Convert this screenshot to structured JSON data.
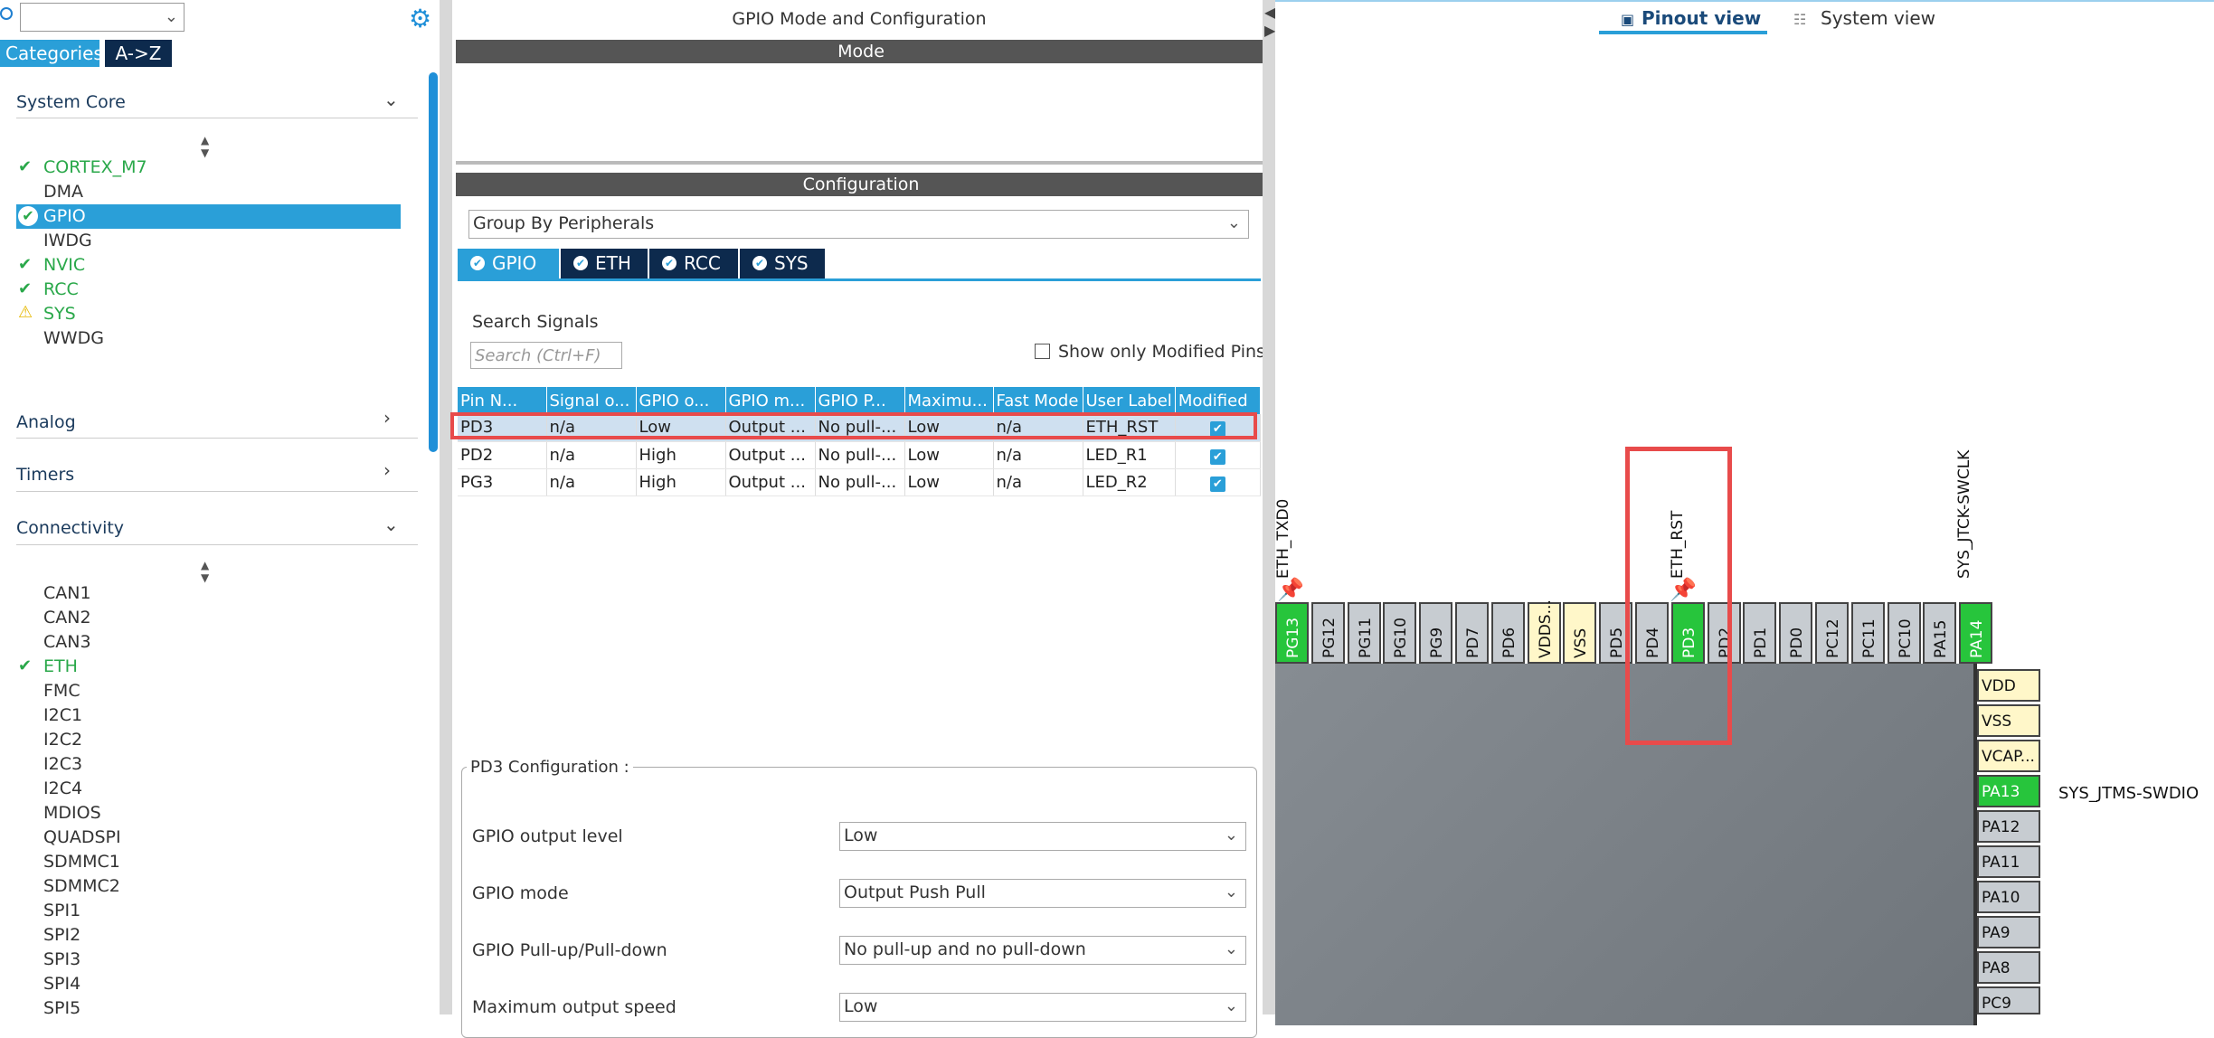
{
  "left": {
    "tabs": [
      "Categories",
      "A->Z"
    ],
    "sections": {
      "system_core": "System Core",
      "analog": "Analog",
      "timers": "Timers",
      "connectivity": "Connectivity"
    },
    "system_core_items": [
      "CORTEX_M7",
      "DMA",
      "GPIO",
      "IWDG",
      "NVIC",
      "RCC",
      "SYS",
      "WWDG"
    ],
    "connectivity_items": [
      "CAN1",
      "CAN2",
      "CAN3",
      "ETH",
      "FMC",
      "I2C1",
      "I2C2",
      "I2C3",
      "I2C4",
      "MDIOS",
      "QUADSPI",
      "SDMMC1",
      "SDMMC2",
      "SPI1",
      "SPI2",
      "SPI3",
      "SPI4",
      "SPI5"
    ]
  },
  "center": {
    "title": "GPIO Mode and Configuration",
    "mode_bar": "Mode",
    "config_bar": "Configuration",
    "group_select": "Group By Peripherals",
    "tabs": [
      "GPIO",
      "ETH",
      "RCC",
      "SYS"
    ],
    "search_label": "Search Signals",
    "search_placeholder": "Search (Ctrl+F)",
    "show_modified_label": "Show only Modified Pins",
    "table": {
      "headers": [
        "Pin N...",
        "Signal o...",
        "GPIO o...",
        "GPIO m...",
        "GPIO P...",
        "Maximu...",
        "Fast Mode",
        "User Label",
        "Modified"
      ],
      "rows": [
        [
          "PD3",
          "n/a",
          "Low",
          "Output ...",
          "No pull-...",
          "Low",
          "n/a",
          "ETH_RST"
        ],
        [
          "PD2",
          "n/a",
          "High",
          "Output ...",
          "No pull-...",
          "Low",
          "n/a",
          "LED_R1"
        ],
        [
          "PG3",
          "n/a",
          "High",
          "Output ...",
          "No pull-...",
          "Low",
          "n/a",
          "LED_R2"
        ]
      ]
    },
    "config_title": "PD3 Configuration :",
    "fields": [
      {
        "label": "GPIO output level",
        "value": "Low"
      },
      {
        "label": "GPIO mode",
        "value": "Output Push Pull"
      },
      {
        "label": "GPIO Pull-up/Pull-down",
        "value": "No pull-up and no pull-down"
      },
      {
        "label": "Maximum output speed",
        "value": "Low"
      }
    ]
  },
  "right": {
    "tabs": [
      "Pinout view",
      "System view"
    ],
    "top_pins": [
      "PG13",
      "PG12",
      "PG11",
      "PG10",
      "PG9",
      "PD7",
      "PD6",
      "VDDS...",
      "VSS",
      "PD5",
      "PD4",
      "PD3",
      "PD2",
      "PD1",
      "PD0",
      "PC12",
      "PC11",
      "PC10",
      "PA15",
      "PA14"
    ],
    "side_pins": [
      "VDD",
      "VSS",
      "VCAP...",
      "PA13",
      "PA12",
      "PA11",
      "PA10",
      "PA9",
      "PA8",
      "PC9"
    ],
    "labels": {
      "eth_txd0": "ETH_TXD0",
      "eth_rst": "ETH_RST",
      "swclk": "SYS_JTCK-SWCLK",
      "swdio": "SYS_JTMS-SWDIO"
    }
  }
}
